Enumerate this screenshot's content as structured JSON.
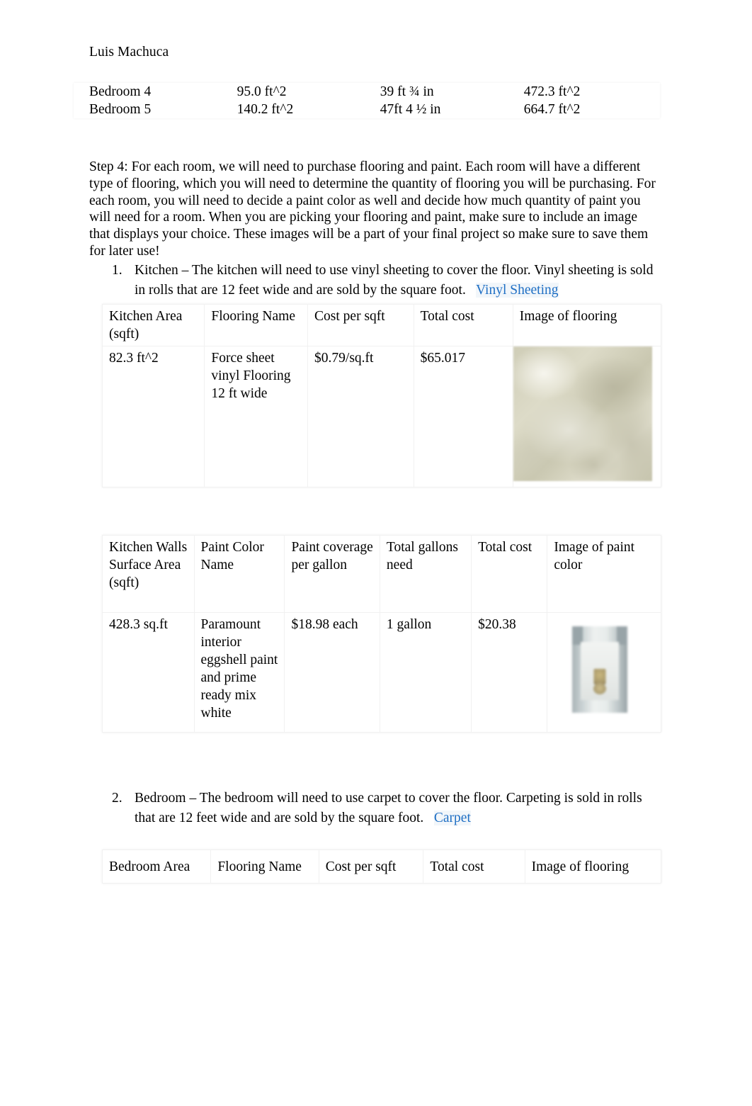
{
  "document": {
    "author": "Luis Machuca"
  },
  "top_table": {
    "rows": [
      {
        "room": "Bedroom 4",
        "area": "95.0 ft^2",
        "perimeter": "39 ft ¾ in",
        "wall_area": "472.3 ft^2"
      },
      {
        "room": "Bedroom 5",
        "area": "140.2 ft^2",
        "perimeter": "47ft 4 ½ in",
        "wall_area": "664.7 ft^2"
      }
    ]
  },
  "step4": {
    "paragraph": "Step 4:  For each room, we will need to purchase flooring and paint. Each room will have a different type of flooring, which you will need to determine the quantity of flooring you will be purchasing. For each room, you will need to decide a paint color as well and decide how much quantity of paint you will need for a room. When you are picking your flooring and paint, make sure to include an image that displays your choice. These images will be a part of your final project so make sure to save them for later use!"
  },
  "items": [
    {
      "number": "1.",
      "text": "Kitchen – The kitchen will need to use vinyl sheeting to cover the floor. Vinyl sheeting is sold in rolls that are 12 feet wide and are sold by the square foot.",
      "link": "Vinyl Sheeting"
    },
    {
      "number": "2.",
      "text": "Bedroom – The bedroom will need to use carpet to cover the floor. Carpeting is sold in rolls that are 12 feet wide and are sold by the square foot.",
      "link": "Carpet"
    }
  ],
  "flooring_table": {
    "headers": {
      "area": "Kitchen Area (sqft)",
      "name": "Flooring Name",
      "cost_per_sqft": "Cost per sqft",
      "total_cost": "Total cost",
      "image": "Image of flooring"
    },
    "row": {
      "area": "82.3 ft^2",
      "name": "Force sheet vinyl Flooring 12 ft wide",
      "cost_per_sqft": "$0.79/sq.ft",
      "total_cost": "$65.017",
      "image_alt": "vinyl-flooring-swatch"
    }
  },
  "paint_table": {
    "headers": {
      "wall_area": "Kitchen Walls Surface Area (sqft)",
      "color_name": "Paint Color Name",
      "coverage": "Paint coverage per gallon",
      "gallons": "Total gallons need",
      "total_cost": "Total cost",
      "image": "Image of paint color"
    },
    "row": {
      "wall_area": "428.3 sq.ft",
      "color_name": "Paramount interior eggshell paint and prime ready mix white",
      "coverage": "$18.98 each",
      "gallons": "1 gallon",
      "total_cost": "$20.38",
      "image_alt": "paint-can-photo"
    }
  },
  "bedroom_table": {
    "headers": {
      "area": "Bedroom Area",
      "name": "Flooring Name",
      "cost_per_sqft": "Cost per sqft",
      "total_cost": "Total cost",
      "image": "Image of flooring"
    }
  },
  "colors": {
    "link": "#1F6FC4",
    "text": "#000000",
    "page_background": "#FFFFFF",
    "table_border": "#F1F1F1"
  }
}
